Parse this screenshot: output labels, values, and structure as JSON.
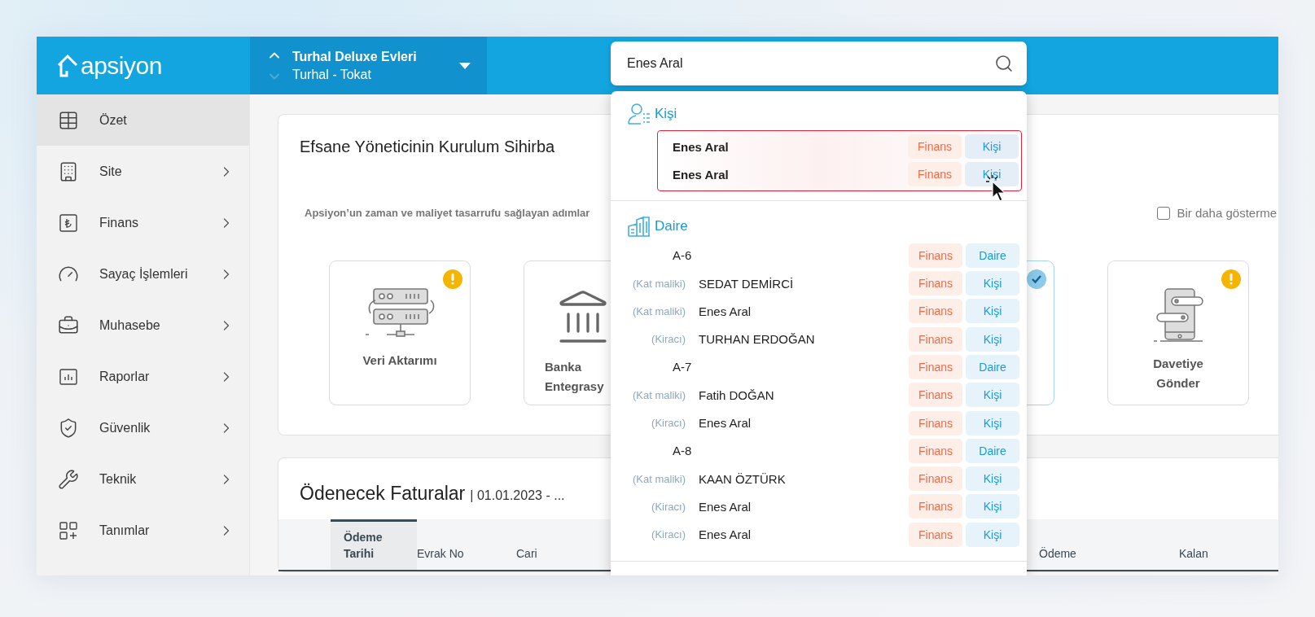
{
  "header": {
    "logo": "apsiyon",
    "site": {
      "name": "Turhal Deluxe Evleri",
      "location": "Turhal - Tokat",
      "up_disabled": false,
      "down_disabled": true
    },
    "search": {
      "value": "Enes Aral"
    }
  },
  "sidebar": {
    "items": [
      {
        "label": "Özet",
        "selected": true,
        "expandable": false
      },
      {
        "label": "Site",
        "selected": false,
        "expandable": true
      },
      {
        "label": "Finans",
        "selected": false,
        "expandable": true
      },
      {
        "label": "Sayaç İşlemleri",
        "selected": false,
        "expandable": true
      },
      {
        "label": "Muhasebe",
        "selected": false,
        "expandable": true
      },
      {
        "label": "Raporlar",
        "selected": false,
        "expandable": true
      },
      {
        "label": "Güvenlik",
        "selected": false,
        "expandable": true
      },
      {
        "label": "Teknik",
        "selected": false,
        "expandable": true
      },
      {
        "label": "Tanımlar",
        "selected": false,
        "expandable": true
      }
    ]
  },
  "setup_card": {
    "title": "Efsane Yöneticinin Kurulum Sihirba",
    "subtitle": "Apsiyon’un zaman ve maliyet tasarrufu sağlayan adımlar",
    "dont_show": {
      "label": "Bir daha gösterme",
      "checked": false
    },
    "steps": [
      {
        "title": "Veri Aktarımı",
        "warning": true,
        "completed": false
      },
      {
        "title": "Banka Entegrasy",
        "warning": false,
        "completed": false
      },
      {
        "warning": false,
        "completed": true
      },
      {
        "title": "Davetiye Gönder",
        "warning": true,
        "completed": false
      }
    ]
  },
  "bills": {
    "title": "Ödenecek Faturalar",
    "range": "| 01.01.2023 - ...",
    "columns": [
      {
        "label": "Ödeme Tarihi",
        "selected": true
      },
      {
        "label": "Evrak No",
        "selected": false
      },
      {
        "label": "Cari",
        "selected": false
      },
      {
        "label": "Ödeme",
        "selected": false
      },
      {
        "label": "Kalan",
        "selected": false
      }
    ]
  },
  "search_results": {
    "sections": [
      {
        "title": "Kişi",
        "highlighted": true,
        "rows": [
          {
            "kind": "person",
            "name": "Enes Aral",
            "actions": [
              {
                "label": "Finans",
                "kind": "finance",
                "hovered": false
              },
              {
                "label": "Kişi",
                "kind": "link",
                "hovered": false
              }
            ]
          },
          {
            "kind": "person",
            "name": "Enes Aral",
            "actions": [
              {
                "label": "Finans",
                "kind": "finance",
                "hovered": false
              },
              {
                "label": "Kişi",
                "kind": "link",
                "hovered": true
              }
            ]
          }
        ]
      },
      {
        "title": "Daire",
        "highlighted": false,
        "rows": [
          {
            "kind": "unit",
            "name": "A-6",
            "actions": [
              {
                "label": "Finans",
                "kind": "finance",
                "hovered": false
              },
              {
                "label": "Daire",
                "kind": "link",
                "hovered": false
              }
            ]
          },
          {
            "kind": "resident",
            "role": "(Kat maliki)",
            "name": "SEDAT DEMİRCİ",
            "actions": [
              {
                "label": "Finans",
                "kind": "finance",
                "hovered": false
              },
              {
                "label": "Kişi",
                "kind": "link",
                "hovered": false
              }
            ]
          },
          {
            "kind": "resident",
            "role": "(Kat maliki)",
            "name": "Enes Aral",
            "actions": [
              {
                "label": "Finans",
                "kind": "finance",
                "hovered": false
              },
              {
                "label": "Kişi",
                "kind": "link",
                "hovered": false
              }
            ]
          },
          {
            "kind": "resident",
            "role": "(Kiracı)",
            "name": "TURHAN ERDOĞAN",
            "actions": [
              {
                "label": "Finans",
                "kind": "finance",
                "hovered": false
              },
              {
                "label": "Kişi",
                "kind": "link",
                "hovered": false
              }
            ]
          },
          {
            "kind": "unit",
            "name": "A-7",
            "actions": [
              {
                "label": "Finans",
                "kind": "finance",
                "hovered": false
              },
              {
                "label": "Daire",
                "kind": "link",
                "hovered": false
              }
            ]
          },
          {
            "kind": "resident",
            "role": "(Kat maliki)",
            "name": "Fatih DOĞAN",
            "actions": [
              {
                "label": "Finans",
                "kind": "finance",
                "hovered": false
              },
              {
                "label": "Kişi",
                "kind": "link",
                "hovered": false
              }
            ]
          },
          {
            "kind": "resident",
            "role": "(Kiracı)",
            "name": "Enes Aral",
            "actions": [
              {
                "label": "Finans",
                "kind": "finance",
                "hovered": false
              },
              {
                "label": "Kişi",
                "kind": "link",
                "hovered": false
              }
            ]
          },
          {
            "kind": "unit",
            "name": "A-8",
            "actions": [
              {
                "label": "Finans",
                "kind": "finance",
                "hovered": false
              },
              {
                "label": "Daire",
                "kind": "link",
                "hovered": false
              }
            ]
          },
          {
            "kind": "resident",
            "role": "(Kat maliki)",
            "name": "KAAN ÖZTÜRK",
            "actions": [
              {
                "label": "Finans",
                "kind": "finance",
                "hovered": false
              },
              {
                "label": "Kişi",
                "kind": "link",
                "hovered": false
              }
            ]
          },
          {
            "kind": "resident",
            "role": "(Kiracı)",
            "name": "Enes Aral",
            "actions": [
              {
                "label": "Finans",
                "kind": "finance",
                "hovered": false
              },
              {
                "label": "Kişi",
                "kind": "link",
                "hovered": false
              }
            ]
          },
          {
            "kind": "resident",
            "role": "(Kiracı)",
            "name": "Enes Aral",
            "actions": [
              {
                "label": "Finans",
                "kind": "finance",
                "hovered": false
              },
              {
                "label": "Kişi",
                "kind": "link",
                "hovered": false
              }
            ]
          }
        ]
      }
    ]
  }
}
